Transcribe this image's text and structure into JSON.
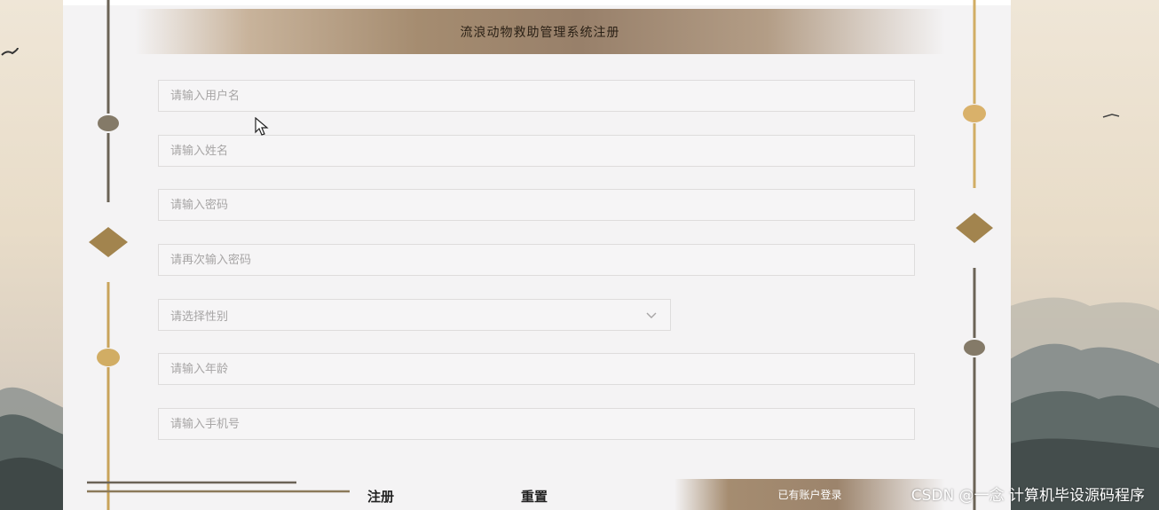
{
  "header": {
    "title": "流浪动物救助管理系统注册"
  },
  "form": {
    "username_placeholder": "请输入用户名",
    "name_placeholder": "请输入姓名",
    "password_placeholder": "请输入密码",
    "confirm_password_placeholder": "请再次输入密码",
    "gender_placeholder": "请选择性别",
    "age_placeholder": "请输入年龄",
    "phone_placeholder": "请输入手机号"
  },
  "actions": {
    "register_label": "注册",
    "reset_label": "重置",
    "login_link_label": "已有账户登录"
  },
  "watermark": "CSDN @一念 计算机毕设源码程序",
  "colors": {
    "accent": "#a58c70",
    "gold": "#c9a35a",
    "panel": "#f4f3f4"
  },
  "icons": {
    "cursor": "arrow-cursor-icon",
    "chevron": "chevron-down-icon"
  }
}
